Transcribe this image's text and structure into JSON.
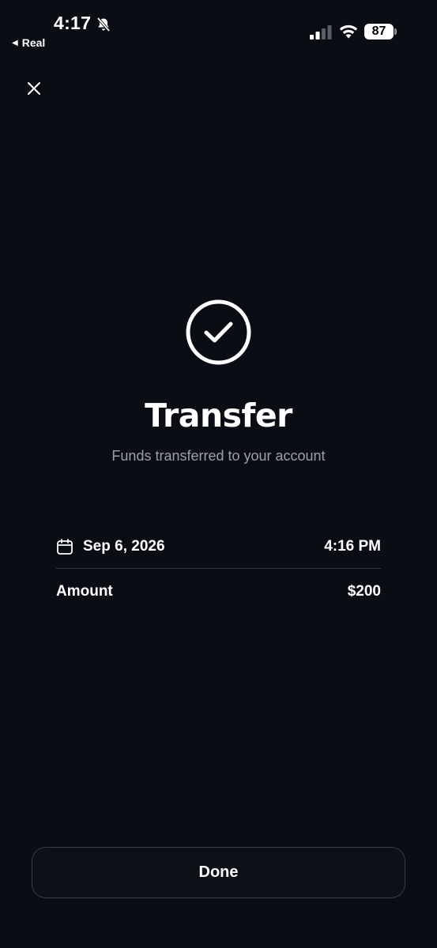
{
  "status_bar": {
    "time": "4:17",
    "back_app_label": "Real",
    "battery_level": "87"
  },
  "header": {
    "close_icon": "close-icon"
  },
  "confirmation": {
    "icon": "check-circle-icon",
    "title": "Transfer",
    "subtitle": "Funds transferred to your account"
  },
  "details": {
    "date": "Sep 6, 2026",
    "time": "4:16 PM",
    "amount_label": "Amount",
    "amount_value": "$200"
  },
  "footer": {
    "done_label": "Done"
  },
  "colors": {
    "background": "#0a0d13",
    "subtitle": "#9ba0ab",
    "divider": "#363a44",
    "button_border": "#3a3e48"
  }
}
